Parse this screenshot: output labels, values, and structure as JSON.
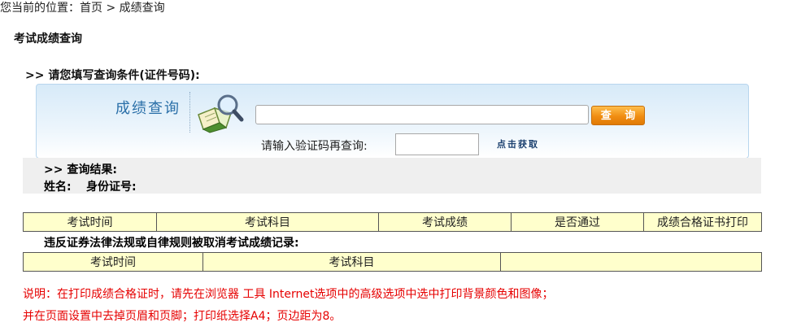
{
  "breadcrumb": {
    "prefix": "您当前的位置：",
    "home": "首页",
    "sep": " > ",
    "current": "成绩查询"
  },
  "page_title": "考试成绩查询",
  "query_condition_title": ">> 请您填写查询条件(证件号码):",
  "panel": {
    "title": "成绩查询",
    "cert_input_value": "",
    "query_button": "查 询",
    "captcha_label": "请输入验证码再查询:",
    "captcha_value": "",
    "get_code_link": "点击获取"
  },
  "result": {
    "title": ">> 查询结果:",
    "name_label": "姓名:",
    "id_label": "身份证号:"
  },
  "scores_table": {
    "headers": [
      "考试时间",
      "考试科目",
      "考试成绩",
      "是否通过",
      "成绩合格证书打印"
    ]
  },
  "revoked": {
    "title": "违反证券法律法规或自律规则被取消考试成绩记录:",
    "headers": [
      "考试时间",
      "考试科目",
      ""
    ]
  },
  "notes": {
    "line1": "说明：在打印成绩合格证时，请先在浏览器 工具 Internet选项中的高级选项中选中打印背景颜色和图像；",
    "line2": "并在页面设置中去掉页眉和页脚；打印纸选择A4；页边距为8。"
  },
  "colors": {
    "accent_blue": "#2a6fa8",
    "button_orange": "#f08d12",
    "table_cell": "#ffffcc",
    "note_red": "#e60000"
  },
  "icons": {
    "panel_icon": "book-magnifier-icon"
  }
}
